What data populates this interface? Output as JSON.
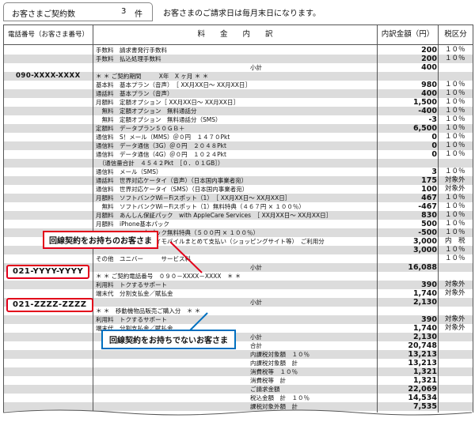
{
  "header": {
    "contract_label": "お客さまご契約数",
    "contract_count": "3",
    "contract_unit": "件",
    "billing_note": "お客さまのご請求日は毎月末日になります。"
  },
  "columns": {
    "phone": "電話番号（お客さま番号）",
    "detail": "料　　金　　内　　訳",
    "amount": "内訳金額（円）",
    "tax": "税区分"
  },
  "rows": [
    {
      "c1": "",
      "c2": "手数料　請求書発行手数料",
      "amt": "200",
      "tax": "１０％"
    },
    {
      "c1": "",
      "c2": "手数料　払込処理手数料",
      "amt": "200",
      "tax": "１０％"
    },
    {
      "c1": "",
      "c2": "　　　　　　　　　　　　　　　　　　　　　　　　　　小計",
      "amt": "400",
      "tax": ""
    },
    {
      "c1": "090-XXXX-XXXX",
      "c2": "＊ ＊ ご契約期間　　　X年　X ヶ月 ＊ ＊",
      "amt": "",
      "tax": ""
    },
    {
      "c1": "",
      "c2": "基本料　基本プラン（音声）　［ XX月XX日～ XX月XX日］",
      "amt": "980",
      "tax": "１０％"
    },
    {
      "c1": "",
      "c2": "通話料　基本プラン（音声）",
      "amt": "400",
      "tax": "１０％"
    },
    {
      "c1": "",
      "c2": "月額料　定額オプション［ XX月XX日～ XX月XX日］",
      "amt": "1,500",
      "tax": "１０％"
    },
    {
      "c1": "",
      "c2": "　無料　定額オプション　無料通話分",
      "amt": "-400",
      "tax": "１０％"
    },
    {
      "c1": "",
      "c2": "　無料　定額オプション　無料通話分（SMS）",
      "amt": "-3",
      "tax": "１０％"
    },
    {
      "c1": "",
      "c2": "定額料　データプラン５０ＧＢ＋",
      "amt": "6,500",
      "tax": "１０％"
    },
    {
      "c1": "",
      "c2": "通信料　S！メール（MMS）＠０円　１４７０Pkt",
      "amt": "0",
      "tax": "１０％"
    },
    {
      "c1": "",
      "c2": "通信料　データ通信（3G）＠０円　２０４８Pkt",
      "amt": "0",
      "tax": "１０％"
    },
    {
      "c1": "",
      "c2": "通信料　データ通信（4G）＠０円　１０２４Pkt",
      "amt": "0",
      "tax": "１０％"
    },
    {
      "c1": "",
      "c2": "　（通信量合計　４５４２Pkt　［０．０１GB］）",
      "amt": "",
      "tax": ""
    },
    {
      "c1": "",
      "c2": "通信料　メール（SMS）",
      "amt": "3",
      "tax": "１０％"
    },
    {
      "c1": "",
      "c2": "通話料　世界対応ケータイ（音声）（日本国内事業者宛）",
      "amt": "175",
      "tax": "対象外"
    },
    {
      "c1": "",
      "c2": "通信料　世界対応ケータイ（SMS）（日本国内事業者宛）",
      "amt": "100",
      "tax": "対象外"
    },
    {
      "c1": "",
      "c2": "月額料　ソフトバンクWi－Fiスポット（1）　［ XX月XX日～ XX月XX日］",
      "amt": "467",
      "tax": "１０％"
    },
    {
      "c1": "",
      "c2": "　無料　ソフトバンクWi－Fiスポット（1）無料特典（４６７円 × １００％）",
      "amt": "-467",
      "tax": "１０％"
    },
    {
      "c1": "",
      "c2": "月額料　あんしん保証パック　with AppleCare Services　［ XX月XX日～ XX月XX日］",
      "amt": "830",
      "tax": "１０％"
    },
    {
      "c1": "",
      "c2": "月額料　iPhone基本パック",
      "amt": "500",
      "tax": "１０％"
    },
    {
      "c1": "",
      "c2": "　　　　　　　　本パック無料特典（５００円 × １００％）",
      "amt": "-500",
      "tax": "１０％"
    },
    {
      "c1": "",
      "c2": "　　　　　　　　　　イモバイルまとめて支払い（ショッピングサイト等）　ご利用分",
      "amt": "3,000",
      "tax": "内　税"
    },
    {
      "c1": "",
      "c2": "",
      "amt": "3,000",
      "tax": "１０％"
    },
    {
      "c1": "",
      "c2": "その他　ユニバー　　　サービス料",
      "amt": "",
      "tax": "１０％"
    },
    {
      "c1": "",
      "c2": "　　　　　　　　　　　　　　　　　　　　　　　　　　小計",
      "amt": "16,088",
      "tax": ""
    },
    {
      "c1": "021-YYYY-YYYY",
      "c2": "＊ ＊ ご契約電話番号　０９０－XXXX－XXXX　＊ ＊",
      "amt": "",
      "tax": ""
    },
    {
      "c1": "",
      "c2": "利用料　トクするサポート",
      "amt": "390",
      "tax": "対象外"
    },
    {
      "c1": "",
      "c2": "端末代　分割支払金／賦払金",
      "amt": "1,740",
      "tax": "対象外"
    },
    {
      "c1": "",
      "c2": "　　　　　　　　　　　　　　　　　　　　　　　　　　小計",
      "amt": "2,130",
      "tax": ""
    },
    {
      "c1": "021-ZZZZ-ZZZZ",
      "c2": "＊ ＊　移動機物品販売ご購入分　＊ ＊",
      "amt": "",
      "tax": ""
    },
    {
      "c1": "",
      "c2": "利用料　トクするサポート",
      "amt": "390",
      "tax": "対象外"
    },
    {
      "c1": "",
      "c2": "端末代　分割支払金／賦払金",
      "amt": "1,740",
      "tax": "対象外"
    },
    {
      "c1": "",
      "c2": "　　　　　　　　　　　　　　　　　　　　　　　　　　小計",
      "amt": "2,130",
      "tax": ""
    },
    {
      "c1": "",
      "c2": "　　　　　　　　　　　　　　　　　　　　　　　　　　合計",
      "amt": "20,748",
      "tax": ""
    },
    {
      "c1": "",
      "c2": "　　　　　　　　　　　　　　　　　　　　　　　　　　内課税対象額　１０％",
      "amt": "13,213",
      "tax": ""
    },
    {
      "c1": "",
      "c2": "　　　　　　　　　　　　　　　　　　　　　　　　　　内課税対象額　計",
      "amt": "13,213",
      "tax": ""
    },
    {
      "c1": "",
      "c2": "　　　　　　　　　　　　　　　　　　　　　　　　　　消費税等　１０％",
      "amt": "1,321",
      "tax": ""
    },
    {
      "c1": "",
      "c2": "　　　　　　　　　　　　　　　　　　　　　　　　　　消費税等　計",
      "amt": "1,321",
      "tax": ""
    },
    {
      "c1": "",
      "c2": "　　　　　　　　　　　　　　　　　　　　　　　　　　ご請求金額",
      "amt": "22,069",
      "tax": ""
    },
    {
      "c1": "",
      "c2": "　　　　　　　　　　　　　　　　　　　　　　　　　　税込金額　計　１０％",
      "amt": "14,534",
      "tax": ""
    },
    {
      "c1": "",
      "c2": "　　　　　　　　　　　　　　　　　　　　　　　　　　課税対象外額　計",
      "amt": "7,535",
      "tax": ""
    }
  ],
  "callouts": {
    "with_line": "回線契約をお持ちのお客さま",
    "without_line": "回線契約をお持ちでないお客さま",
    "tag1": "021-YYYY-YYYY",
    "tag2": "021-ZZZZ-ZZZZ"
  },
  "colors": {
    "red": "#e2001a",
    "blue": "#0070c0",
    "stripe": "#dcdcdc"
  }
}
